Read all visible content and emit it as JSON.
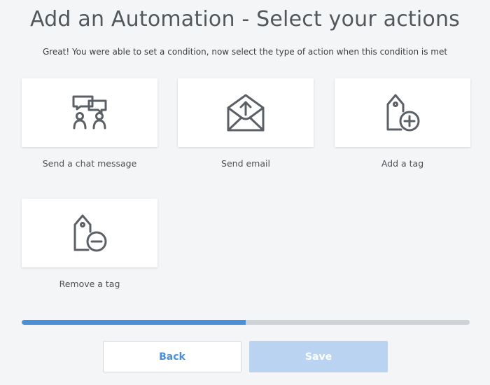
{
  "header": {
    "title": "Add an Automation - Select your actions",
    "subtitle": "Great! You were able to set a condition, now select the type of action when this condition is met"
  },
  "actions": [
    {
      "label": "Send a chat message",
      "icon": "chat-people-icon"
    },
    {
      "label": "Send email",
      "icon": "email-upload-icon"
    },
    {
      "label": "Add a tag",
      "icon": "tag-add-icon"
    },
    {
      "label": "Remove a tag",
      "icon": "tag-remove-icon"
    }
  ],
  "progress": {
    "percent": 50
  },
  "footer": {
    "back_label": "Back",
    "save_label": "Save"
  },
  "colors": {
    "accent": "#4a90d9",
    "accent_light": "#b9d3f1",
    "icon": "#5b6066",
    "track": "#cfd3d7"
  }
}
